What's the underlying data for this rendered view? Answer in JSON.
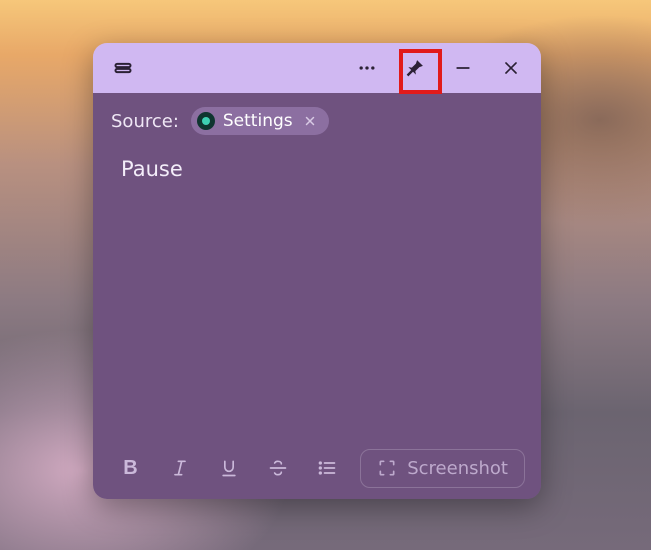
{
  "titlebar": {
    "menu_icon": "menu-icon",
    "more_icon": "more-icon",
    "pin_icon": "pin-icon",
    "minimize_icon": "minimize-icon",
    "close_icon": "close-icon"
  },
  "source": {
    "label": "Source:",
    "chip_text": "Settings"
  },
  "content": {
    "text": "Pause"
  },
  "toolbar": {
    "bold": "B",
    "screenshot_label": "Screenshot"
  },
  "colors": {
    "titlebar_bg": "#d0b8f2",
    "body_bg": "#6f527f",
    "highlight_border": "#e11a1a"
  }
}
